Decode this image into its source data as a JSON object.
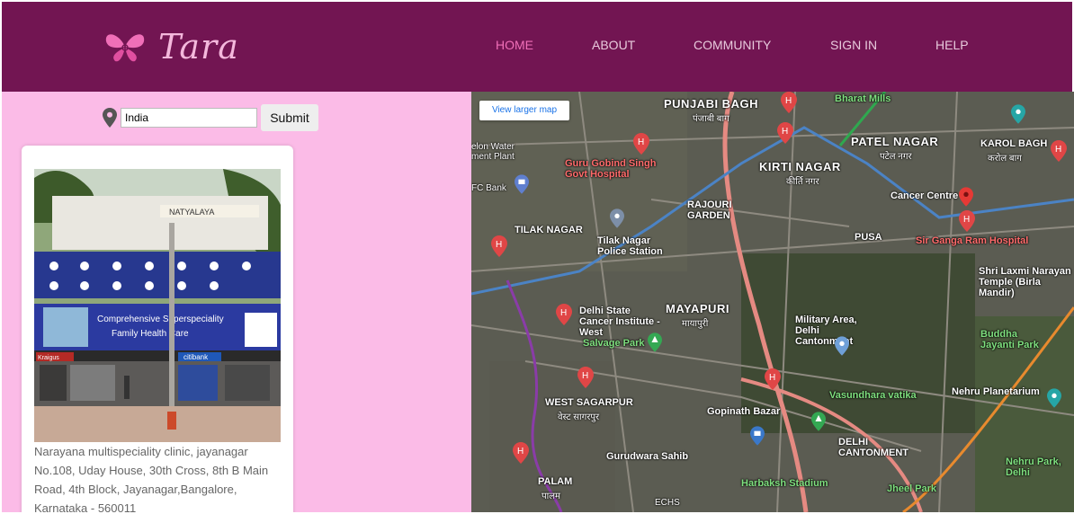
{
  "brand": {
    "name": "Tara"
  },
  "nav": {
    "items": [
      {
        "label": "HOME",
        "active": true
      },
      {
        "label": "ABOUT",
        "active": false
      },
      {
        "label": "COMMUNITY",
        "active": false
      },
      {
        "label": "SIGN IN",
        "active": false
      },
      {
        "label": "HELP",
        "active": false
      }
    ]
  },
  "search": {
    "value": "India",
    "submit_label": "Submit",
    "icon": "map-pin-icon"
  },
  "clinic": {
    "address": "Narayana multispeciality clinic, jayanagar No.108, Uday House, 30th Cross, 8th B Main Road, 4th Block, Jayanagar,Bangalore, Karnataka - 560011",
    "photo_signs": {
      "top": "NATYALAYA",
      "banner": "Comprehensive Superspeciality",
      "banner2": "Family Health Care",
      "bank": "citibank",
      "store": "Kraigus"
    }
  },
  "map": {
    "view_larger": "View larger map",
    "labels": {
      "punjabi_bagh": "PUNJABI BAGH",
      "punjabi_bagh_hi": "पंजाबी बाग",
      "patel_nagar": "PATEL NAGAR",
      "patel_nagar_hi": "पटेल नगर",
      "karol_bagh": "KAROL BAGH",
      "karol_bagh_hi": "करोल बाग",
      "kirti_nagar": "KIRTI NAGAR",
      "kirti_nagar_hi": "कीर्ति नगर",
      "guru_gobind": "Guru Gobind Singh Govt Hospital",
      "cancer_centre": "Cancer Centre",
      "rajouri": "RAJOURI GARDEN",
      "tilak_nagar": "TILAK NAGAR",
      "tilak_police": "Tilak Nagar Police Station",
      "pusa": "PUSA",
      "sir_ganga": "Sir Ganga Ram Hospital",
      "laxmi": "Shri Laxmi Narayan Temple (Birla Mandir)",
      "delhi_state": "Delhi State Cancer Institute - West",
      "mayapuri": "MAYAPURI",
      "mayapuri_hi": "मायापुरी",
      "military": "Military Area, Delhi Cantonment",
      "salvage": "Salvage Park",
      "buddha": "Buddha Jayanti Park",
      "west_sagarpur": "WEST SAGARPUR",
      "west_sagarpur_hi": "वेस्ट सागरपुर",
      "vasundhara": "Vasundhara vatika",
      "nehru_planet": "Nehru Planetarium",
      "gopinath": "Gopinath Bazar",
      "delhi_cant": "DELHI CANTONMENT",
      "gurudwara": "Gurudwara Sahib",
      "harbaksh": "Harbaksh Stadium",
      "jheel": "Jheel Park",
      "nehru_park": "Nehru Park, Delhi",
      "palam": "PALAM",
      "palam_hi": "पालम",
      "bharat": "Bharat Mills",
      "water": "elon Water ment Plant",
      "fc_bank": "FC Bank",
      "echs": "ECHS"
    }
  }
}
